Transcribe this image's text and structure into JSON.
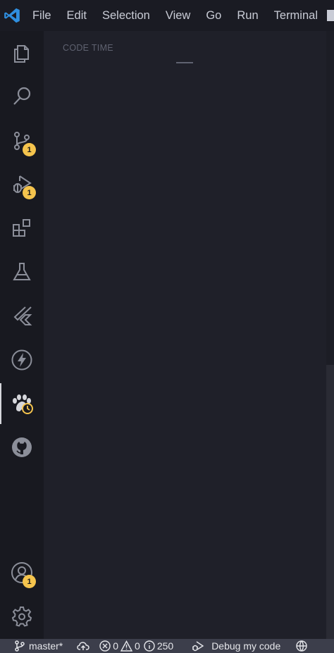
{
  "menu": {
    "items": [
      "File",
      "Edit",
      "Selection",
      "View",
      "Go",
      "Run",
      "Terminal"
    ]
  },
  "activity_bar": {
    "items": [
      {
        "name": "explorer",
        "icon": "files-icon"
      },
      {
        "name": "search",
        "icon": "search-icon"
      },
      {
        "name": "source-control",
        "icon": "source-control-icon",
        "badge": "1"
      },
      {
        "name": "run-and-debug",
        "icon": "run-debug-icon",
        "badge": "1"
      },
      {
        "name": "extensions",
        "icon": "extensions-icon"
      },
      {
        "name": "testing",
        "icon": "flask-icon"
      },
      {
        "name": "flutter",
        "icon": "flutter-icon"
      },
      {
        "name": "thunder-client",
        "icon": "lightning-icon"
      },
      {
        "name": "code-time",
        "icon": "paw-clock-icon",
        "active": true
      },
      {
        "name": "github",
        "icon": "github-icon"
      }
    ],
    "accounts": {
      "icon": "account-icon",
      "badge": "1"
    },
    "manage": {
      "icon": "gear-icon"
    }
  },
  "sidebar": {
    "title": "CODE TIME"
  },
  "status_bar": {
    "branch": "master*",
    "errors": "0",
    "warnings": "0",
    "info": "250",
    "debug_label": "Debug my code"
  },
  "colors": {
    "badge": "#f5c44d",
    "status_bar": "#3c3e4b",
    "vscode_blue": "#2f8fe0"
  }
}
